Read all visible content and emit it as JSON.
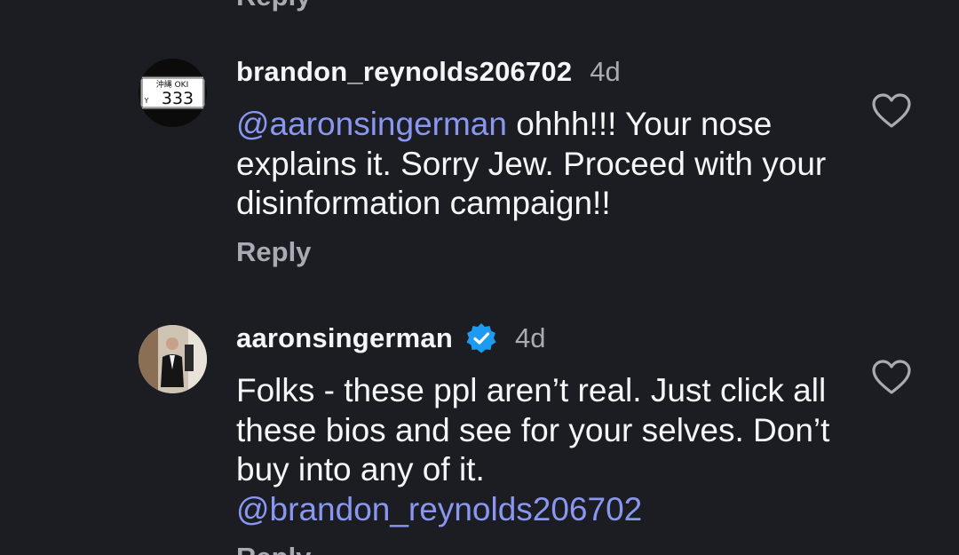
{
  "top_partial": {
    "reply_label": "Reply"
  },
  "comments": [
    {
      "username": "brandon_reynolds206702",
      "time": "4d",
      "verified": false,
      "avatar_plate": {
        "region": "沖縄 OKI",
        "letter": "Y",
        "number": "333"
      },
      "mention": "@aaronsingerman",
      "text": " ohhh!!! Your nose explains it. Sorry Jew. Proceed with your disinformation campaign!!",
      "reply_label": "Reply"
    },
    {
      "username": "aaronsingerman",
      "time": "4d",
      "verified": true,
      "text": "Folks - these ppl aren’t real. Just click all these bios and see for your selves. Don’t buy into any of it.",
      "mention": "@brandon_reynolds206702",
      "reply_label": "Reply"
    }
  ],
  "colors": {
    "background": "#1b1d22",
    "text": "#f5f6f8",
    "secondary": "#a8abb2",
    "mention": "#8a97f0",
    "verified": "#1d9bf0"
  }
}
